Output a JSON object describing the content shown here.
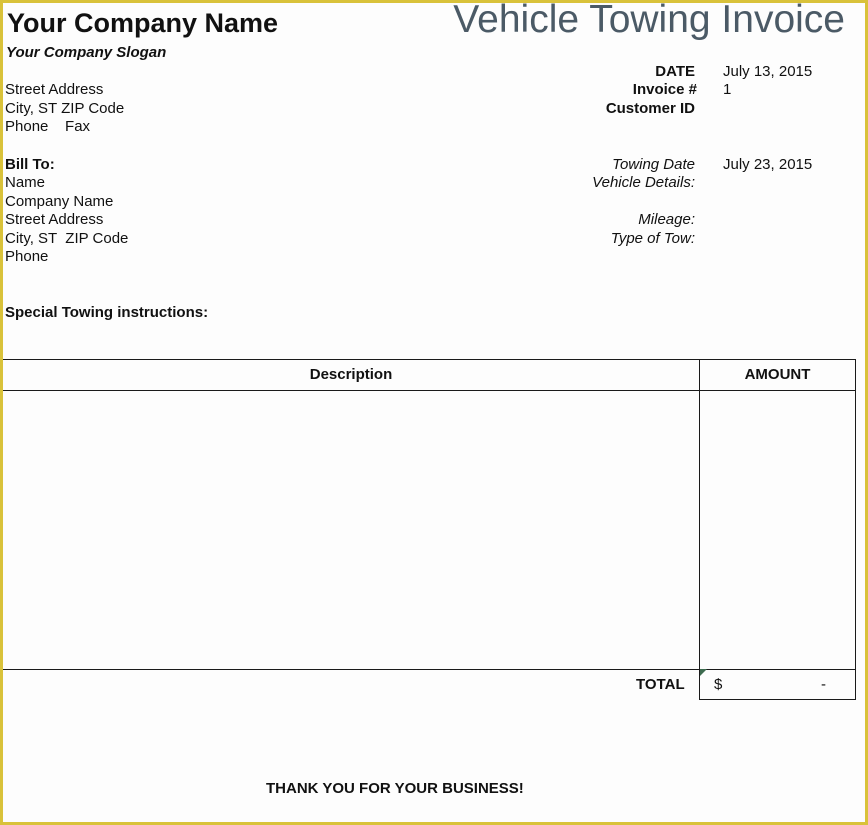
{
  "header": {
    "company_name": "Your Company Name",
    "slogan": "Your Company Slogan",
    "title": "Vehicle Towing Invoice"
  },
  "company_address": {
    "street": "Street Address",
    "city": "City, ST  ZIP Code",
    "phone_fax": "Phone    Fax"
  },
  "invoice_info": {
    "date_label": "DATE",
    "date_value": "July 13, 2015",
    "invoice_label": "Invoice #",
    "invoice_value": "1",
    "customer_label": "Customer ID",
    "customer_value": ""
  },
  "bill_to": {
    "label": "Bill To:",
    "name": "Name",
    "company": "Company Name",
    "street": "Street Address",
    "city": "City, ST  ZIP Code",
    "phone": "Phone"
  },
  "towing": {
    "date_label": "Towing Date",
    "date_value": "July 23, 2015",
    "vehicle_label": "Vehicle Details:",
    "mileage_label": "Mileage:",
    "type_label": "Type of Tow:"
  },
  "instructions_label": "Special Towing instructions:",
  "table": {
    "headers": [
      "Description",
      "AMOUNT"
    ],
    "rows": [],
    "total_label": "TOTAL",
    "total_currency": "$",
    "total_value": "-"
  },
  "footer": {
    "thanks": "THANK YOU FOR YOUR BUSINESS!"
  },
  "colors": {
    "border": "#d9c23a",
    "title": "#4b5a66"
  }
}
